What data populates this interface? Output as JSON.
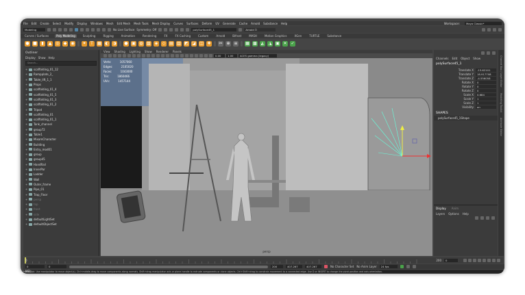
{
  "menubar": {
    "items": [
      "File",
      "Edit",
      "Create",
      "Select",
      "Modify",
      "Display",
      "Windows",
      "Mesh",
      "Edit Mesh",
      "Mesh Tools",
      "Mesh Display",
      "Curves",
      "Surfaces",
      "Deform",
      "UV",
      "Generate",
      "Cache",
      "Arnold",
      "Substance",
      "Help"
    ],
    "workspace_label": "Workspace:",
    "workspace_value": "Maya Classic*"
  },
  "statusline": {
    "mode": "Modeling",
    "live_surface": "No Live Surface",
    "symmetry": "Symmetry: Off",
    "selected_object": "polySurface45_1",
    "renderer": "Arnold Ö"
  },
  "shelf": {
    "tabs": [
      "Curves / Surfaces",
      "Poly Modeling",
      "Sculpting",
      "Rigging",
      "Animation",
      "Rendering",
      "FX",
      "FX Caching",
      "Custom",
      "Arnold",
      "Bifrost",
      "MASH",
      "Motion Graphics",
      "XGen",
      "TURTLE",
      "Substance"
    ],
    "active_tab": "Poly Modeling"
  },
  "outliner": {
    "title": "Outliner",
    "menu": [
      "Display",
      "Show",
      "Help"
    ],
    "search_placeholder": "Search...",
    "items": [
      {
        "label": "scaffolding_01_12",
        "dim": false
      },
      {
        "label": "Rampplate_2_",
        "dim": false
      },
      {
        "label": "Table_lift_1_1",
        "dim": false
      },
      {
        "label": "Props",
        "dim": false
      },
      {
        "label": "scaffolding_01_4",
        "dim": false
      },
      {
        "label": "scaffolding_01_5",
        "dim": false
      },
      {
        "label": "scaffolding_01_3",
        "dim": false
      },
      {
        "label": "scaffolding_01_2",
        "dim": false
      },
      {
        "label": "Tripod",
        "dim": false
      },
      {
        "label": "scaffolding_01",
        "dim": false
      },
      {
        "label": "scaffolding_01_1",
        "dim": false
      },
      {
        "label": "Tank_channel",
        "dim": false
      },
      {
        "label": "group72",
        "dim": false
      },
      {
        "label": "Table1",
        "dim": false
      },
      {
        "label": "MixamCharacter",
        "dim": false
      },
      {
        "label": "Building",
        "dim": false
      },
      {
        "label": "Entry_mod01",
        "dim": false
      },
      {
        "label": "group",
        "dim": false
      },
      {
        "label": "group45",
        "dim": false
      },
      {
        "label": "HandRail",
        "dim": false
      },
      {
        "label": "InnerPar",
        "dim": false
      },
      {
        "label": "Ladder",
        "dim": false
      },
      {
        "label": "Wall",
        "dim": false
      },
      {
        "label": "Outer_frame",
        "dim": false
      },
      {
        "label": "Pipe_01",
        "dim": false
      },
      {
        "label": "Trap_Floor",
        "dim": false
      },
      {
        "label": "persp",
        "dim": true
      },
      {
        "label": "top",
        "dim": true
      },
      {
        "label": "front",
        "dim": true
      },
      {
        "label": "side",
        "dim": true
      },
      {
        "label": "defaultLightSet",
        "dim": false
      },
      {
        "label": "defaultObjectSet",
        "dim": false
      }
    ]
  },
  "viewport": {
    "menu": [
      "View",
      "Shading",
      "Lighting",
      "Show",
      "Renderer",
      "Panels"
    ],
    "exposure": "0.00",
    "gamma": "1.00",
    "color_space": "ACES gamma (legacy)",
    "camera_label": "persp",
    "hud": [
      {
        "label": "Verts:",
        "value": "1057060"
      },
      {
        "label": "Edges:",
        "value": "2105020"
      },
      {
        "label": "Faces:",
        "value": "1043000"
      },
      {
        "label": "Tris:",
        "value": "1860466"
      },
      {
        "label": "UVs:",
        "value": "1457144"
      }
    ]
  },
  "channel_box": {
    "menu": [
      "Channels",
      "Edit",
      "Object",
      "Show"
    ],
    "object_name": "polySurface45_1",
    "attributes": [
      {
        "label": "Translate X",
        "value": "-13.62101"
      },
      {
        "label": "Translate Y",
        "value": "18.917708"
      },
      {
        "label": "Translate Z",
        "value": "-4.556058"
      },
      {
        "label": "Rotate X",
        "value": "0"
      },
      {
        "label": "Rotate Y",
        "value": "0"
      },
      {
        "label": "Rotate Z",
        "value": "0"
      },
      {
        "label": "Scale X",
        "value": "0.684"
      },
      {
        "label": "Scale Y",
        "value": "1"
      },
      {
        "label": "Scale Z",
        "value": "1"
      },
      {
        "label": "Visibility",
        "value": "on"
      }
    ],
    "shapes_title": "SHAPES",
    "shape_item": "polySurface45_1Shape",
    "layer_tabs": [
      "Display",
      "Anim"
    ],
    "layer_menu": [
      "Layers",
      "Options",
      "Help"
    ]
  },
  "side_tabs": [
    "Channel Box / Layer Editor",
    "Modeling Toolkit",
    "Attribute Editor"
  ],
  "timeslider": {
    "start": "0",
    "end": "200",
    "current": "0"
  },
  "range": {
    "start": "0",
    "inner_start": "0",
    "inner_end": "200",
    "end": "407.267",
    "end2": "407.267",
    "character_set": "No Character Set",
    "anim_layer": "No Anim Layer",
    "fps": "24 fps"
  },
  "cmdline": {
    "label": "MEL"
  },
  "helpline": "Move Tool: Use manipulator to move object(s). Ctrl+middle-drag to move components along normals. Shift+drag manipulator axis or plane handle to extrude components or clone objects. Ctrl+Shift+drag to constrain movement to a connected edge. Use D or INSERT to change the pivot position and axis orientation.",
  "colors": {
    "outliner_bg": "#3b3b3b",
    "viewport_bg": "#8c8c8c",
    "accent": "#5285a6",
    "shelf_orange": "#e89a2a",
    "shelf_green": "#4aa24a"
  }
}
